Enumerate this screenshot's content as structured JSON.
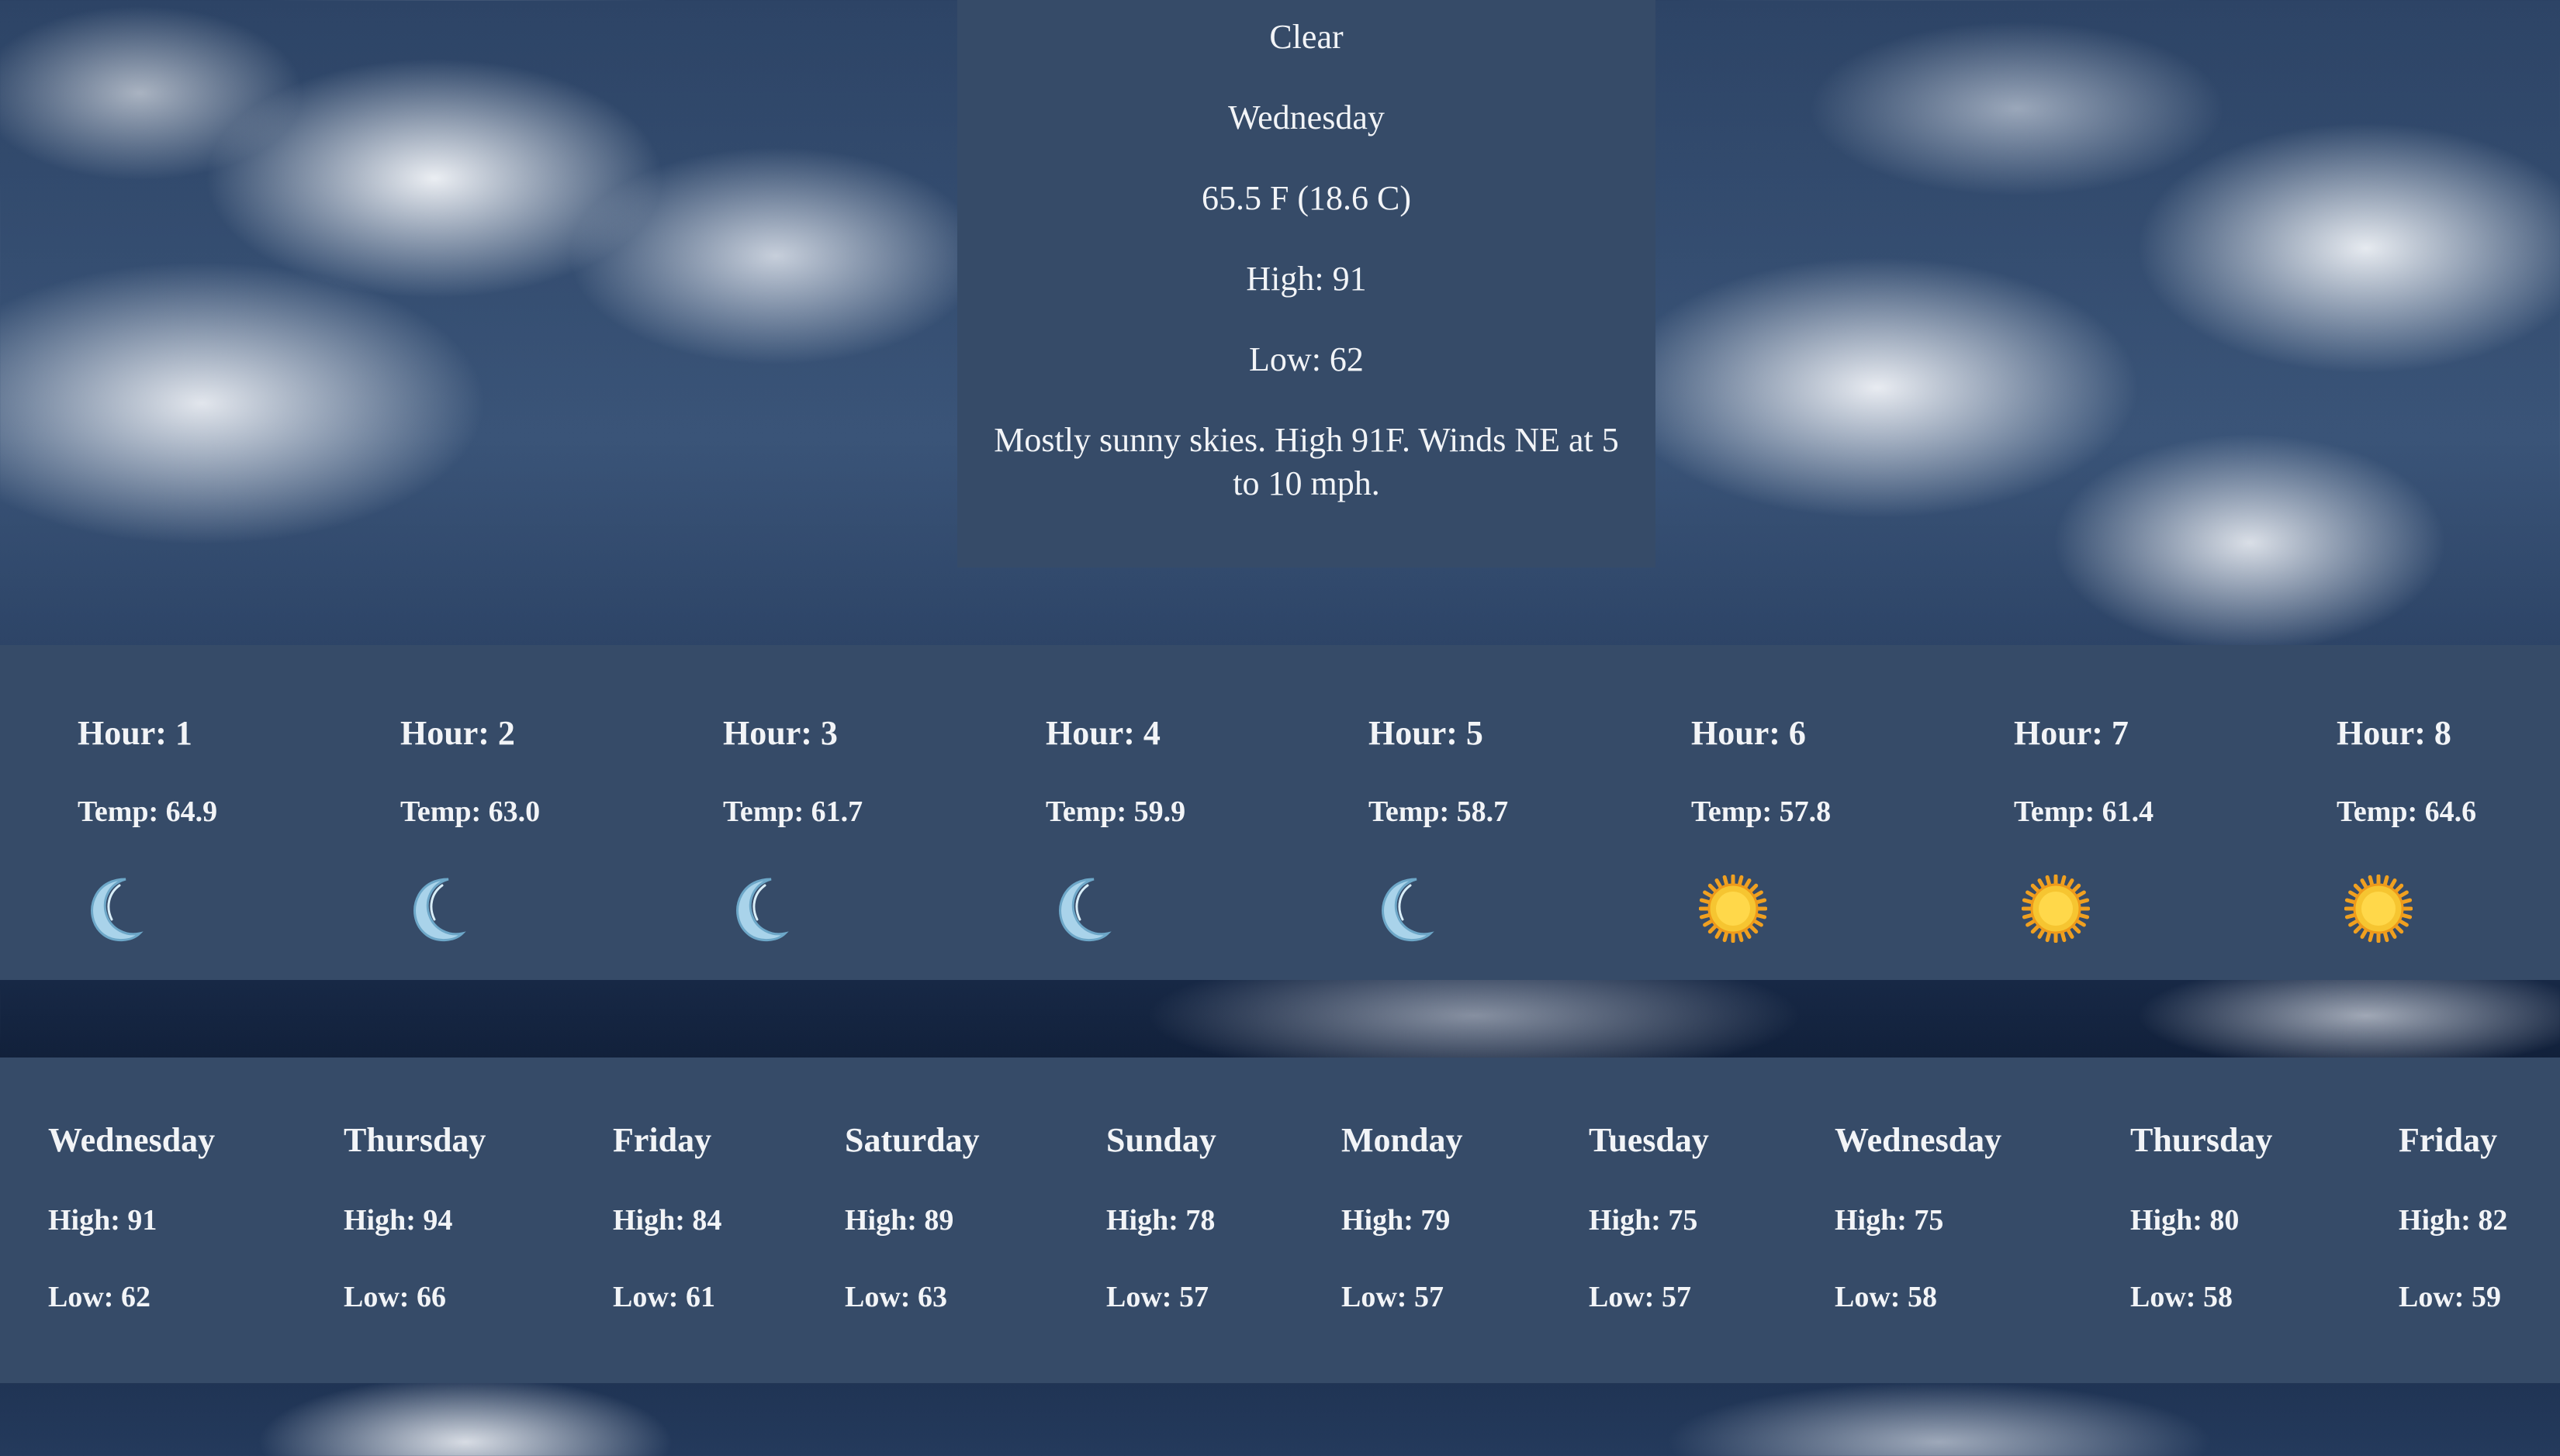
{
  "current": {
    "condition": "Clear",
    "day": "Wednesday",
    "temperature": "65.5 F (18.6 C)",
    "high": "High: 91",
    "low": "Low: 62",
    "summary": "Mostly sunny skies. High 91F. Winds NE at 5 to 10 mph."
  },
  "hourly": [
    {
      "hour": "Hour: 1",
      "temp": "Temp: 64.9",
      "icon": "moon-icon"
    },
    {
      "hour": "Hour: 2",
      "temp": "Temp: 63.0",
      "icon": "moon-icon"
    },
    {
      "hour": "Hour: 3",
      "temp": "Temp: 61.7",
      "icon": "moon-icon"
    },
    {
      "hour": "Hour: 4",
      "temp": "Temp: 59.9",
      "icon": "moon-icon"
    },
    {
      "hour": "Hour: 5",
      "temp": "Temp: 58.7",
      "icon": "moon-icon"
    },
    {
      "hour": "Hour: 6",
      "temp": "Temp: 57.8",
      "icon": "sun-icon"
    },
    {
      "hour": "Hour: 7",
      "temp": "Temp: 61.4",
      "icon": "sun-icon"
    },
    {
      "hour": "Hour: 8",
      "temp": "Temp: 64.6",
      "icon": "sun-icon"
    }
  ],
  "daily": [
    {
      "day": "Wednesday",
      "high": "High: 91",
      "low": "Low: 62"
    },
    {
      "day": "Thursday",
      "high": "High: 94",
      "low": "Low: 66"
    },
    {
      "day": "Friday",
      "high": "High: 84",
      "low": "Low: 61"
    },
    {
      "day": "Saturday",
      "high": "High: 89",
      "low": "Low: 63"
    },
    {
      "day": "Sunday",
      "high": "High: 78",
      "low": "Low: 57"
    },
    {
      "day": "Monday",
      "high": "High: 79",
      "low": "Low: 57"
    },
    {
      "day": "Tuesday",
      "high": "High: 75",
      "low": "Low: 57"
    },
    {
      "day": "Wednesday",
      "high": "High: 75",
      "low": "Low: 58"
    },
    {
      "day": "Thursday",
      "high": "High: 80",
      "low": "Low: 58"
    },
    {
      "day": "Friday",
      "high": "High: 82",
      "low": "Low: 59"
    }
  ],
  "colors": {
    "panel": "#364b68",
    "text": "#f2f4f7",
    "sun": "#f6c531",
    "moon": "#a9d3ea"
  }
}
